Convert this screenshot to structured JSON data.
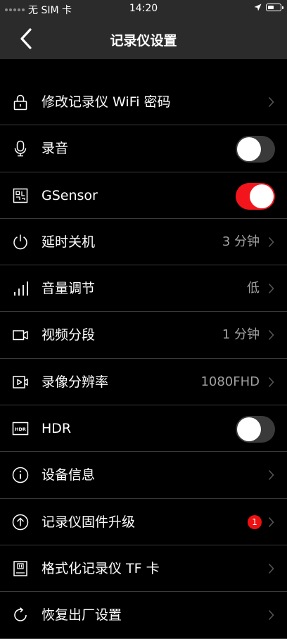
{
  "status_bar": {
    "carrier": "无 SIM 卡",
    "time": "14:20"
  },
  "header": {
    "title": "记录仪设置"
  },
  "colors": {
    "background": "#000000",
    "bar": "#2b2b2b",
    "accent": "#f2161c",
    "divider": "#3a3a3a",
    "secondary_text": "#a0a0a0"
  },
  "settings": [
    {
      "label": "修改记录仪 WiFi 密码",
      "icon": "lock-icon",
      "control": "chevron"
    },
    {
      "label": "录音",
      "icon": "microphone-icon",
      "control": "toggle",
      "on": false
    },
    {
      "label": "GSensor",
      "icon": "gsensor-icon",
      "control": "toggle",
      "on": true
    },
    {
      "label": "延时关机",
      "icon": "power-icon",
      "control": "value",
      "value": "3 分钟"
    },
    {
      "label": "音量调节",
      "icon": "volume-bars-icon",
      "control": "value",
      "value": "低"
    },
    {
      "label": "视频分段",
      "icon": "video-camera-icon",
      "control": "value",
      "value": "1 分钟"
    },
    {
      "label": "录像分辨率",
      "icon": "video-play-icon",
      "control": "value",
      "value": "1080FHD"
    },
    {
      "label": "HDR",
      "icon": "hdr-icon",
      "control": "toggle",
      "on": false
    },
    {
      "label": "设备信息",
      "icon": "info-icon",
      "control": "chevron"
    },
    {
      "label": "记录仪固件升级",
      "icon": "upgrade-icon",
      "control": "badge",
      "badge": "1"
    },
    {
      "label": "格式化记录仪 TF 卡",
      "icon": "sd-card-icon",
      "control": "chevron"
    },
    {
      "label": "恢复出厂设置",
      "icon": "reset-icon",
      "control": "chevron"
    }
  ]
}
